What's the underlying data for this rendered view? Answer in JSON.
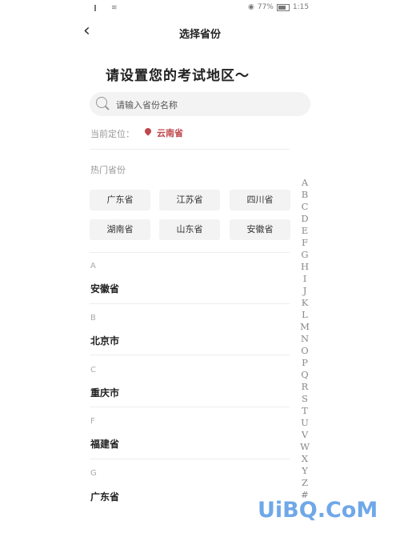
{
  "status_bar": {
    "battery": "77%",
    "time": "1:15"
  },
  "header": {
    "back_icon": "chevron-left-icon",
    "title": "选择省份"
  },
  "prompt": "请设置您的考试地区～",
  "search": {
    "placeholder": "请输入省份名称"
  },
  "current_location": {
    "label": "当前定位：",
    "value": "云南省"
  },
  "hot": {
    "title": "热门省份",
    "items": [
      "广东省",
      "江苏省",
      "四川省",
      "湖南省",
      "山东省",
      "安徽省"
    ]
  },
  "groups": [
    {
      "letter": "A",
      "province": "安徽省"
    },
    {
      "letter": "B",
      "province": "北京市"
    },
    {
      "letter": "C",
      "province": "重庆市"
    },
    {
      "letter": "F",
      "province": "福建省"
    },
    {
      "letter": "G",
      "province": "广东省"
    }
  ],
  "index_letters": [
    "A",
    "B",
    "C",
    "D",
    "E",
    "F",
    "G",
    "H",
    "I",
    "J",
    "K",
    "L",
    "M",
    "N",
    "O",
    "P",
    "Q",
    "R",
    "S",
    "T",
    "U",
    "V",
    "W",
    "X",
    "Y",
    "Z",
    "#"
  ],
  "watermark": "UiBQ.CoM",
  "colors": {
    "accent": "#c0464b",
    "chip_bg": "#f3f3f3",
    "watermark": "#6fa8e8"
  }
}
